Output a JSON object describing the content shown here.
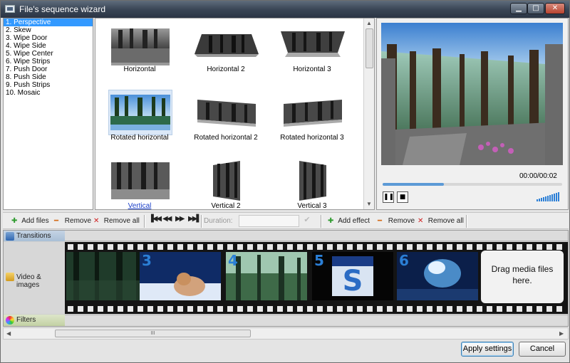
{
  "window": {
    "title": "File's sequence wizard"
  },
  "effects": {
    "items": [
      "1. Perspective",
      "2. Skew",
      "3. Wipe Door",
      "4. Wipe Side",
      "5. Wipe Center",
      "6. Wipe Strips",
      "7. Push Door",
      "8. Push Side",
      "9. Push Strips",
      "10. Mosaic"
    ],
    "selected_index": 0
  },
  "thumbnails": [
    {
      "label": "Horizontal"
    },
    {
      "label": "Horizontal 2"
    },
    {
      "label": "Horizontal 3"
    },
    {
      "label": "Rotated horizontal"
    },
    {
      "label": "Rotated horizontal 2"
    },
    {
      "label": "Rotated horizontal 3"
    },
    {
      "label": "Vertical"
    },
    {
      "label": "Vertical 2"
    },
    {
      "label": "Vertical 3"
    }
  ],
  "preview": {
    "time": "00:00/00:02",
    "progress": 0.34
  },
  "toolbar": {
    "add_files": "Add files",
    "remove": "Remove",
    "remove_all": "Remove all",
    "duration_label": "Duration:",
    "duration_value": "",
    "add_effect": "Add effect",
    "remove2": "Remove",
    "remove_all2": "Remove all"
  },
  "timeline": {
    "transitions_label": "Transitions",
    "video_label": "Video & images",
    "filters_label": "Filters",
    "clips": [
      "",
      "3",
      "4",
      "5",
      "6"
    ],
    "drop_line1": "Drag media files",
    "drop_line2": "here.",
    "scroll_thumb": "III"
  },
  "buttons": {
    "apply": "Apply settings",
    "cancel": "Cancel"
  },
  "colors": {
    "title_bar": "#3a4656",
    "selection": "#3399ff",
    "accent_blue": "#2b7fd6"
  }
}
